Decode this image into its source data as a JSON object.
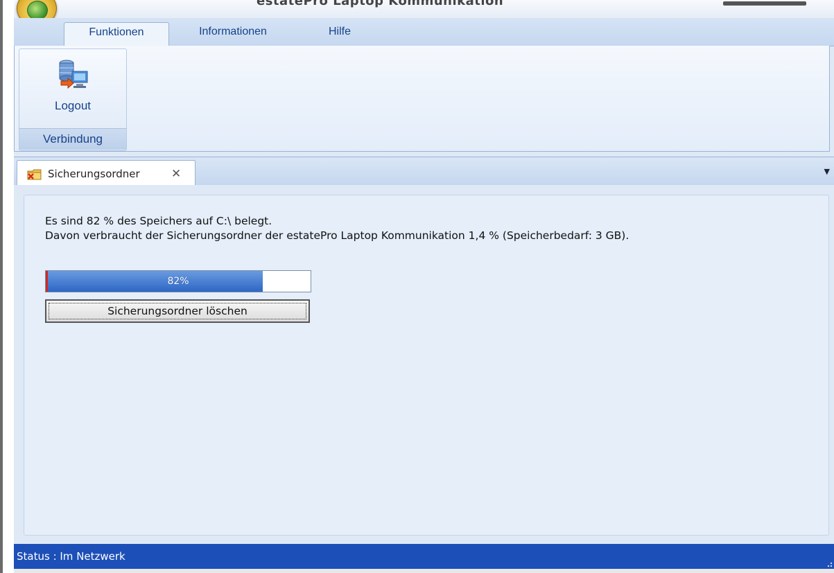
{
  "window": {
    "title": "estatePro Laptop Kommunikation"
  },
  "ribbon": {
    "tabs": [
      {
        "label": "Funktionen",
        "active": true
      },
      {
        "label": "Informationen",
        "active": false
      },
      {
        "label": "Hilfe",
        "active": false
      }
    ],
    "group": {
      "name": "Verbindung",
      "buttons": [
        {
          "label": "Logout",
          "icon": "logout-computer-icon"
        }
      ]
    }
  },
  "document_tabs": [
    {
      "label": "Sicherungsordner",
      "icon": "folder-delete-icon",
      "close_glyph": "✕"
    }
  ],
  "content": {
    "line1": "Es sind 82 % des Speichers auf C:\\ belegt.",
    "line2": "Davon verbraucht der Sicherungsordner der estatePro Laptop Kommunikation 1,4 % (Speicherbedarf: 3 GB).",
    "progress": {
      "value": 0.82,
      "label": "82%"
    },
    "delete_button_label": "Sicherungsordner löschen"
  },
  "status": {
    "text": "Status : Im Netzwerk"
  },
  "colors": {
    "ribbon_text": "#15428b",
    "status_bar": "#1d4fb8",
    "progress_fill": "#2e67c4",
    "progress_mark": "#d0281f"
  }
}
